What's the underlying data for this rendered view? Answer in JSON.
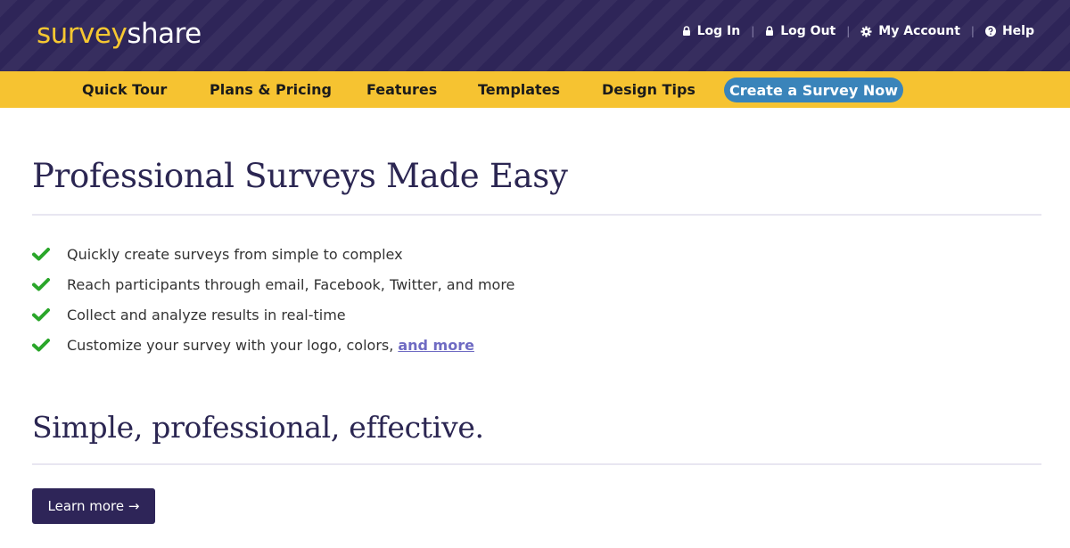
{
  "header": {
    "logo_part1": "survey",
    "logo_part2": "share",
    "utility_links": [
      {
        "label": "Log In",
        "icon": "lock-icon"
      },
      {
        "label": "Log Out",
        "icon": "lock-icon"
      },
      {
        "label": "My Account",
        "icon": "gear-icon"
      },
      {
        "label": "Help",
        "icon": "question-icon"
      }
    ]
  },
  "nav": {
    "items": [
      "Quick Tour",
      "Plans & Pricing",
      "Features",
      "Templates",
      "Design Tips"
    ],
    "cta_label": "Create a Survey Now"
  },
  "main": {
    "title": "Professional Surveys Made Easy",
    "features": [
      "Quickly create surveys from simple to complex",
      "Reach participants through email, Facebook, Twitter, and more",
      "Collect and analyze results in real-time",
      "Customize your survey with your logo, colors,"
    ],
    "features_link": "and more",
    "subtitle": "Simple, professional, effective.",
    "learn_more_label": "Learn more →"
  },
  "colors": {
    "header_bg": "#2e2558",
    "nav_bg": "#f6c331",
    "logo_accent": "#f6c731",
    "cta_bg": "#3a84ba",
    "check_green": "#2aa62a",
    "link_color": "#6f6bc3"
  }
}
